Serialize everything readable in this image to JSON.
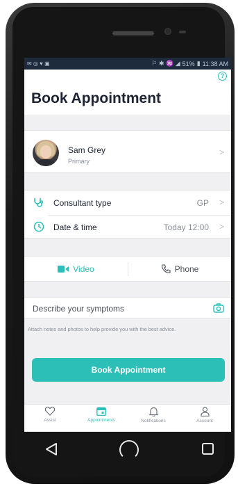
{
  "status": {
    "left_icons": "✉ ◎ ♥ ▣",
    "signal": "⚐ ✱ ♒ ◢",
    "battery": "51%",
    "time": "11:38 AM"
  },
  "header": {
    "help": "?",
    "title": "Book Appointment"
  },
  "profile": {
    "name": "Sam Grey",
    "role": "Primary"
  },
  "rows": [
    {
      "label": "Consultant type",
      "value": "GP"
    },
    {
      "label": "Date & time",
      "value": "Today 12:00"
    }
  ],
  "media": {
    "video": "Video",
    "phone": "Phone"
  },
  "symptoms": {
    "label": "Describe your symptoms",
    "note": "Attach notes and photos to help provide you with the best advice."
  },
  "book_button": "Book Appointment",
  "tabs": [
    {
      "label": "Assist"
    },
    {
      "label": "Appointments"
    },
    {
      "label": "Notifications"
    },
    {
      "label": "Account"
    }
  ],
  "chevron": ">",
  "colors": {
    "accent": "#2bbfb8",
    "status_bar": "#1e2b3d",
    "title": "#1d2333"
  }
}
